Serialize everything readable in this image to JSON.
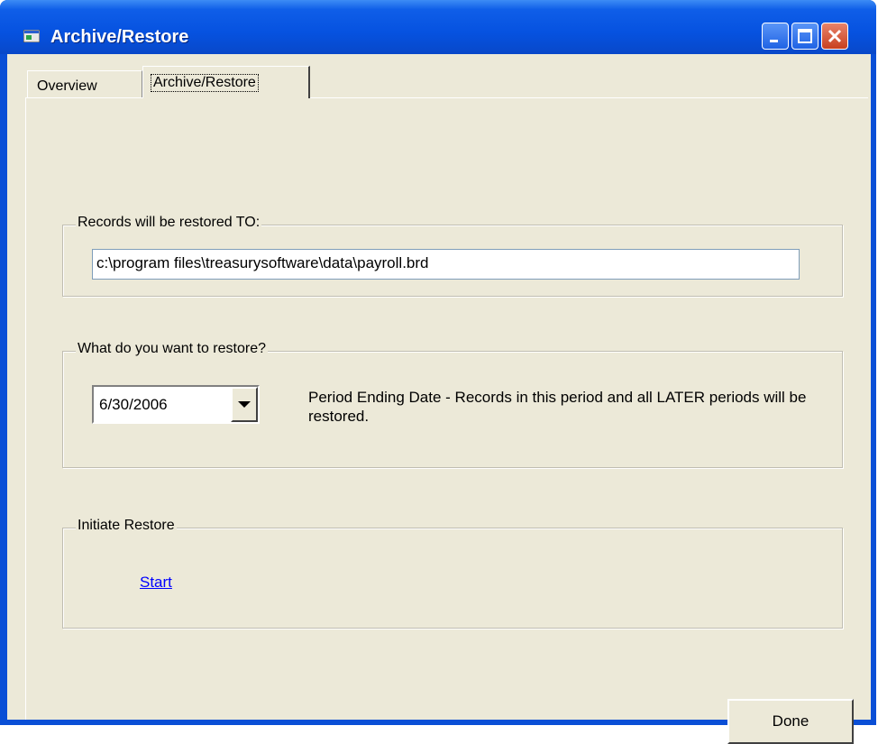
{
  "window": {
    "title": "Archive/Restore",
    "icon": "app-window-icon",
    "controls": [
      "minimize-icon",
      "maximize-icon",
      "close-icon"
    ]
  },
  "tabs": [
    {
      "label": "Overview",
      "selected": false
    },
    {
      "label": "Archive/Restore",
      "selected": true
    }
  ],
  "restore_to": {
    "legend": "Records will be restored TO:",
    "path": "c:\\program files\\treasurysoftware\\data\\payroll.brd"
  },
  "what_to_restore": {
    "legend": "What do you want to restore?",
    "selected_date": "6/30/2006",
    "description": "Period Ending Date - Records in this period and all LATER periods will be restored."
  },
  "initiate": {
    "legend": "Initiate Restore",
    "start_link": "Start"
  },
  "footer": {
    "done_label": "Done"
  },
  "colors": {
    "titlebar": "#0652e0",
    "dialog_bg": "#ece9d8",
    "link": "#0000ff",
    "close_button": "#c8401f"
  }
}
